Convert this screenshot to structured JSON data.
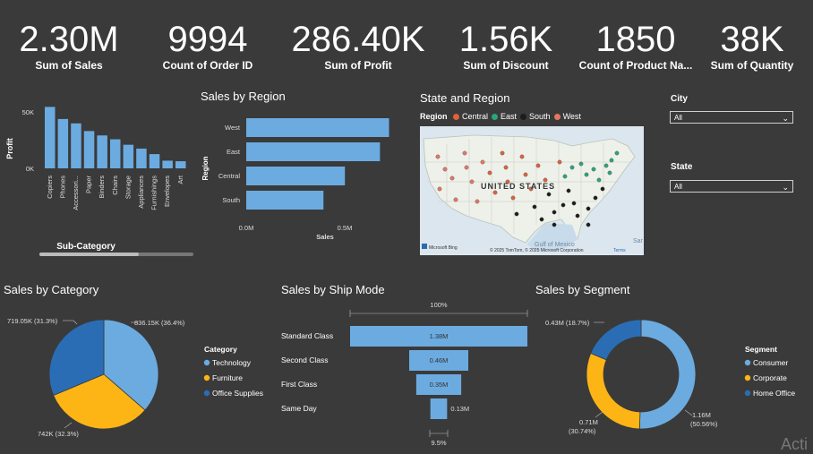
{
  "kpis": [
    {
      "value": "2.30M",
      "label": "Sum of Sales"
    },
    {
      "value": "9994",
      "label": "Count of Order ID"
    },
    {
      "value": "286.40K",
      "label": "Sum of Profit"
    },
    {
      "value": "1.56K",
      "label": "Sum of Discount"
    },
    {
      "value": "1850",
      "label": "Count of Product Na..."
    },
    {
      "value": "38K",
      "label": "Sum of Quantity"
    }
  ],
  "subcat_chart": {
    "ylabel": "Profit",
    "xlabel": "Sub-Category",
    "ticks": [
      "50K",
      "0K"
    ]
  },
  "region_chart": {
    "title": "Sales by Region",
    "ylabel": "Region",
    "xlabel": "Sales",
    "ticks": [
      "0.0M",
      "0.5M"
    ]
  },
  "map_panel": {
    "title": "State and Region",
    "legend_title": "Region",
    "legend": [
      {
        "name": "Central",
        "color": "#e0603a"
      },
      {
        "name": "East",
        "color": "#2aa57a"
      },
      {
        "name": "South",
        "color": "#1c1c1c"
      },
      {
        "name": "West",
        "color": "#e87560"
      }
    ],
    "country_label": "UNITED STATES",
    "gulf_label": "Gulf of Mexico",
    "copyright": "© 2025 TomTom, © 2025 Microsoft Corporation",
    "terms": "Terms",
    "bing": "Microsoft Bing",
    "sea_label": "Sar"
  },
  "filters": {
    "city": {
      "label": "City",
      "value": "All"
    },
    "state": {
      "label": "State",
      "value": "All"
    }
  },
  "category_chart": {
    "title": "Sales by Category",
    "legend_title": "Category",
    "labels": [
      "836.15K (36.4%)",
      "742K (32.3%)",
      "719.05K (31.3%)"
    ]
  },
  "shipmode_chart": {
    "title": "Sales by Ship Mode",
    "top_label": "100%",
    "bottom_label": "9.5%",
    "value_labels": [
      "1.38M",
      "0.46M",
      "0.35M",
      "0.13M"
    ]
  },
  "segment_chart": {
    "title": "Sales by Segment",
    "legend_title": "Segment",
    "labels": [
      "1.16M",
      "(50.56%)",
      "0.71M",
      "(30.74%)",
      "0.43M (18.7%)"
    ]
  },
  "watermark": "Acti",
  "chart_data": [
    {
      "type": "bar",
      "title": "",
      "xlabel": "Sub-Category",
      "ylabel": "Profit",
      "categories": [
        "Copiers",
        "Phones",
        "Accessori...",
        "Paper",
        "Binders",
        "Chairs",
        "Storage",
        "Appliances",
        "Furnishings",
        "Envelopes",
        "Art"
      ],
      "values": [
        56000,
        45000,
        41000,
        34000,
        30000,
        26500,
        21500,
        18000,
        13000,
        7000,
        6500
      ],
      "ylim": [
        0,
        60000
      ]
    },
    {
      "type": "bar",
      "title": "Sales by Region",
      "xlabel": "Sales",
      "ylabel": "Region",
      "categories": [
        "West",
        "East",
        "Central",
        "South"
      ],
      "values": [
        725000,
        679000,
        501000,
        392000
      ],
      "xlim": [
        0,
        750000
      ]
    },
    {
      "type": "pie",
      "title": "Sales by Category",
      "categories": [
        "Technology",
        "Furniture",
        "Office Supplies"
      ],
      "values": [
        836150,
        742000,
        719050
      ],
      "colors": [
        "#6cabe0",
        "#fdb515",
        "#2a6db5"
      ]
    },
    {
      "type": "bar",
      "title": "Sales by Ship Mode",
      "categories": [
        "Standard Class",
        "Second Class",
        "First Class",
        "Same Day"
      ],
      "values": [
        1380000,
        460000,
        350000,
        130000
      ]
    },
    {
      "type": "pie",
      "title": "Sales by Segment",
      "categories": [
        "Consumer",
        "Corporate",
        "Home Office"
      ],
      "values": [
        1160000,
        710000,
        430000
      ],
      "colors": [
        "#6cabe0",
        "#fdb515",
        "#2a6db5"
      ]
    }
  ]
}
